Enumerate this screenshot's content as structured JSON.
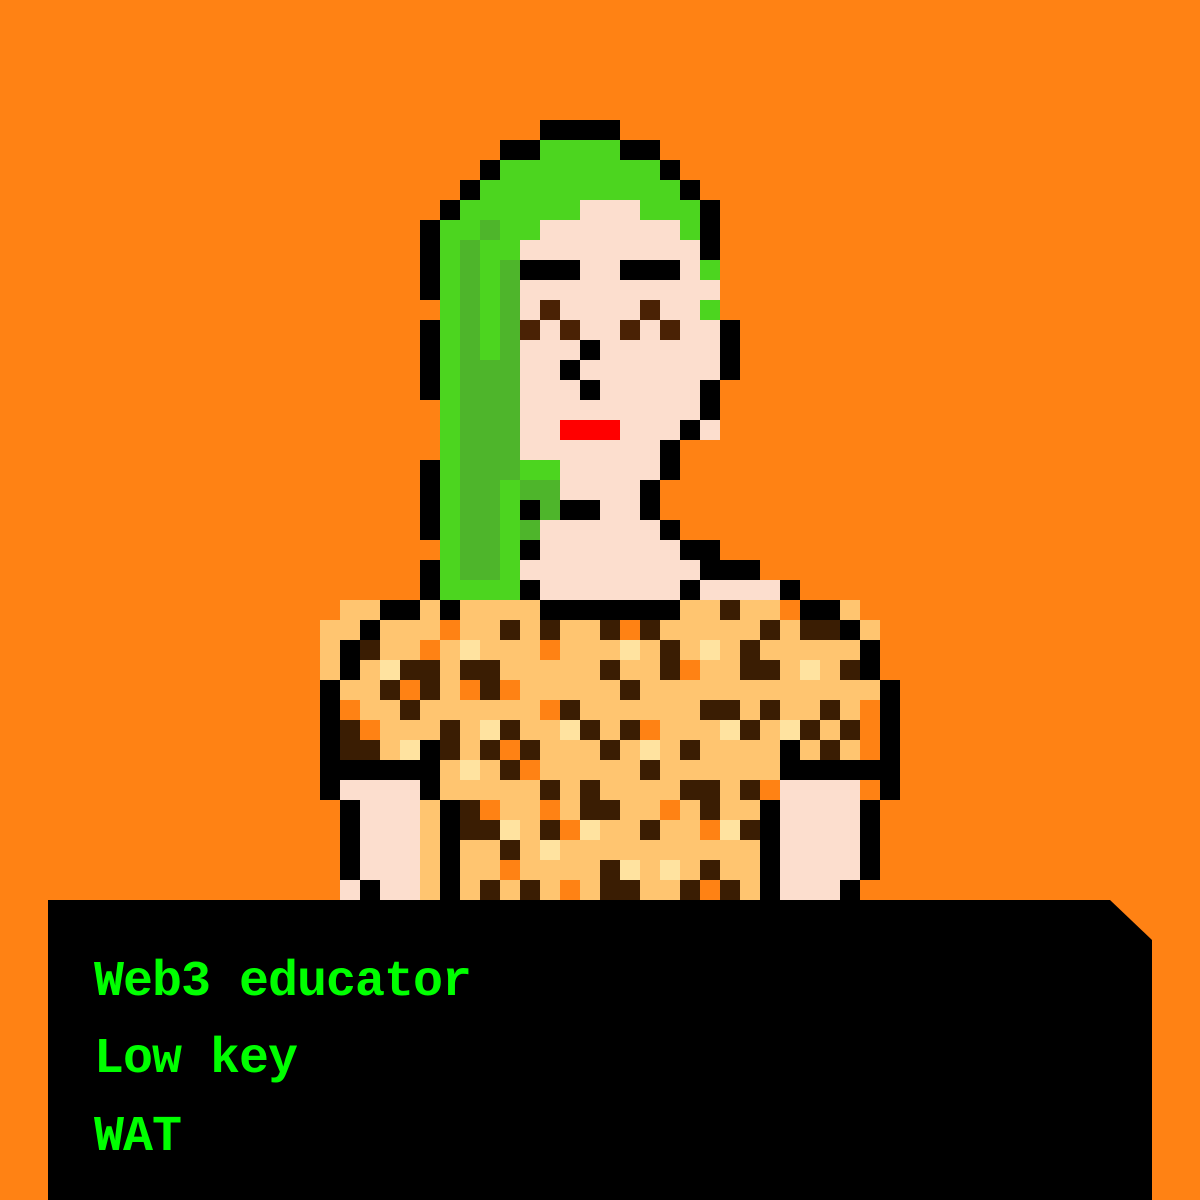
{
  "colors": {
    "background": "#ff8214",
    "outline": "#000000",
    "skin": "#fcdece",
    "hair": "#4cd51f",
    "hair_shadow": "#4eb52b",
    "eye": "#4a2205",
    "lips": "#ff0000",
    "shirt_base": "#ffc570",
    "shirt_spot_dark": "#3a1d03",
    "shirt_spot_light": "#ffe3a0",
    "text": "#00ff00",
    "panel": "#000000"
  },
  "avatar": {
    "description_icon": "pixel-portrait-icon"
  },
  "info_panel": {
    "lines": [
      "Web3 educator",
      "Low key",
      "WAT"
    ]
  }
}
